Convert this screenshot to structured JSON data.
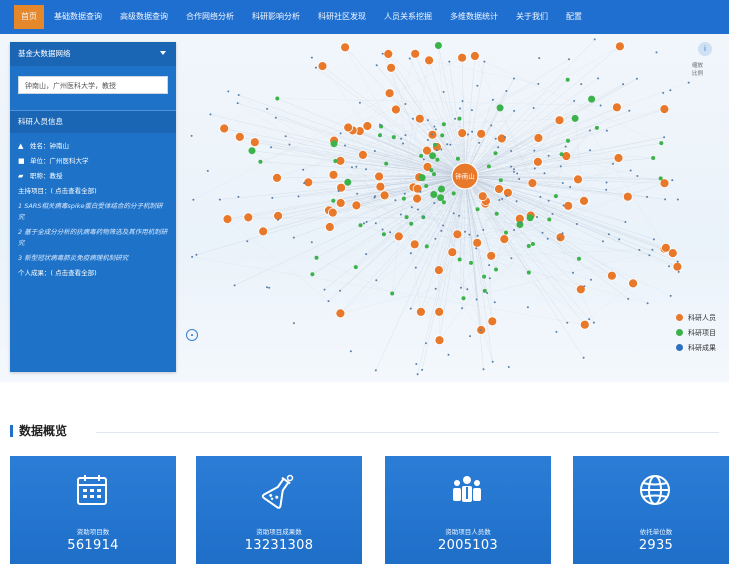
{
  "nav": {
    "items": [
      {
        "label": "首页",
        "active": true
      },
      {
        "label": "基础数据查询"
      },
      {
        "label": "高级数据查询"
      },
      {
        "label": "合作网络分析"
      },
      {
        "label": "科研影响分析"
      },
      {
        "label": "科研社区发现"
      },
      {
        "label": "人员关系挖掘"
      },
      {
        "label": "多维数据统计"
      },
      {
        "label": "关于我们"
      },
      {
        "label": "配置"
      }
    ]
  },
  "left_panel": {
    "title": "基金大数据网络",
    "search_value": "钟南山，广州医科大学，教授",
    "info_title": "科研人员信息",
    "name_row": "姓名：钟南山",
    "org_row": "单位：广州医科大学",
    "title_row": "职称：教授",
    "projects_row": "主持项目：( 点击查看全部)",
    "project_1": "1 SARS相关病毒spike蛋白受体结合的分子机制研究",
    "project_2": "2 基于全成分分析的抗病毒药物筛选及其作用机制研究",
    "project_3": "3 新型冠状病毒肺炎免疫病理机制研究",
    "achievements_row": "个人成果：( 点击查看全部)"
  },
  "graph": {
    "center_label": "钟南山",
    "colors": {
      "person": "#e8782a",
      "project": "#3cb34a",
      "achievement": "#2f6fc0"
    },
    "zoom_text": [
      "缩放",
      "比例"
    ],
    "badge": "i"
  },
  "legend": {
    "items": [
      {
        "label": "科研人员",
        "color": "#e8782a"
      },
      {
        "label": "科研项目",
        "color": "#3cb34a"
      },
      {
        "label": "科研成果",
        "color": "#2f6fc0"
      }
    ]
  },
  "overview": {
    "title": "数据概览",
    "cards": [
      {
        "label": "资助项目数",
        "value": "561914",
        "icon": "calendar-icon"
      },
      {
        "label": "资助项目成果数",
        "value": "13231308",
        "icon": "flask-icon"
      },
      {
        "label": "资助项目人员数",
        "value": "2005103",
        "icon": "people-icon"
      },
      {
        "label": "依托单位数",
        "value": "2935",
        "icon": "globe-icon"
      }
    ]
  }
}
